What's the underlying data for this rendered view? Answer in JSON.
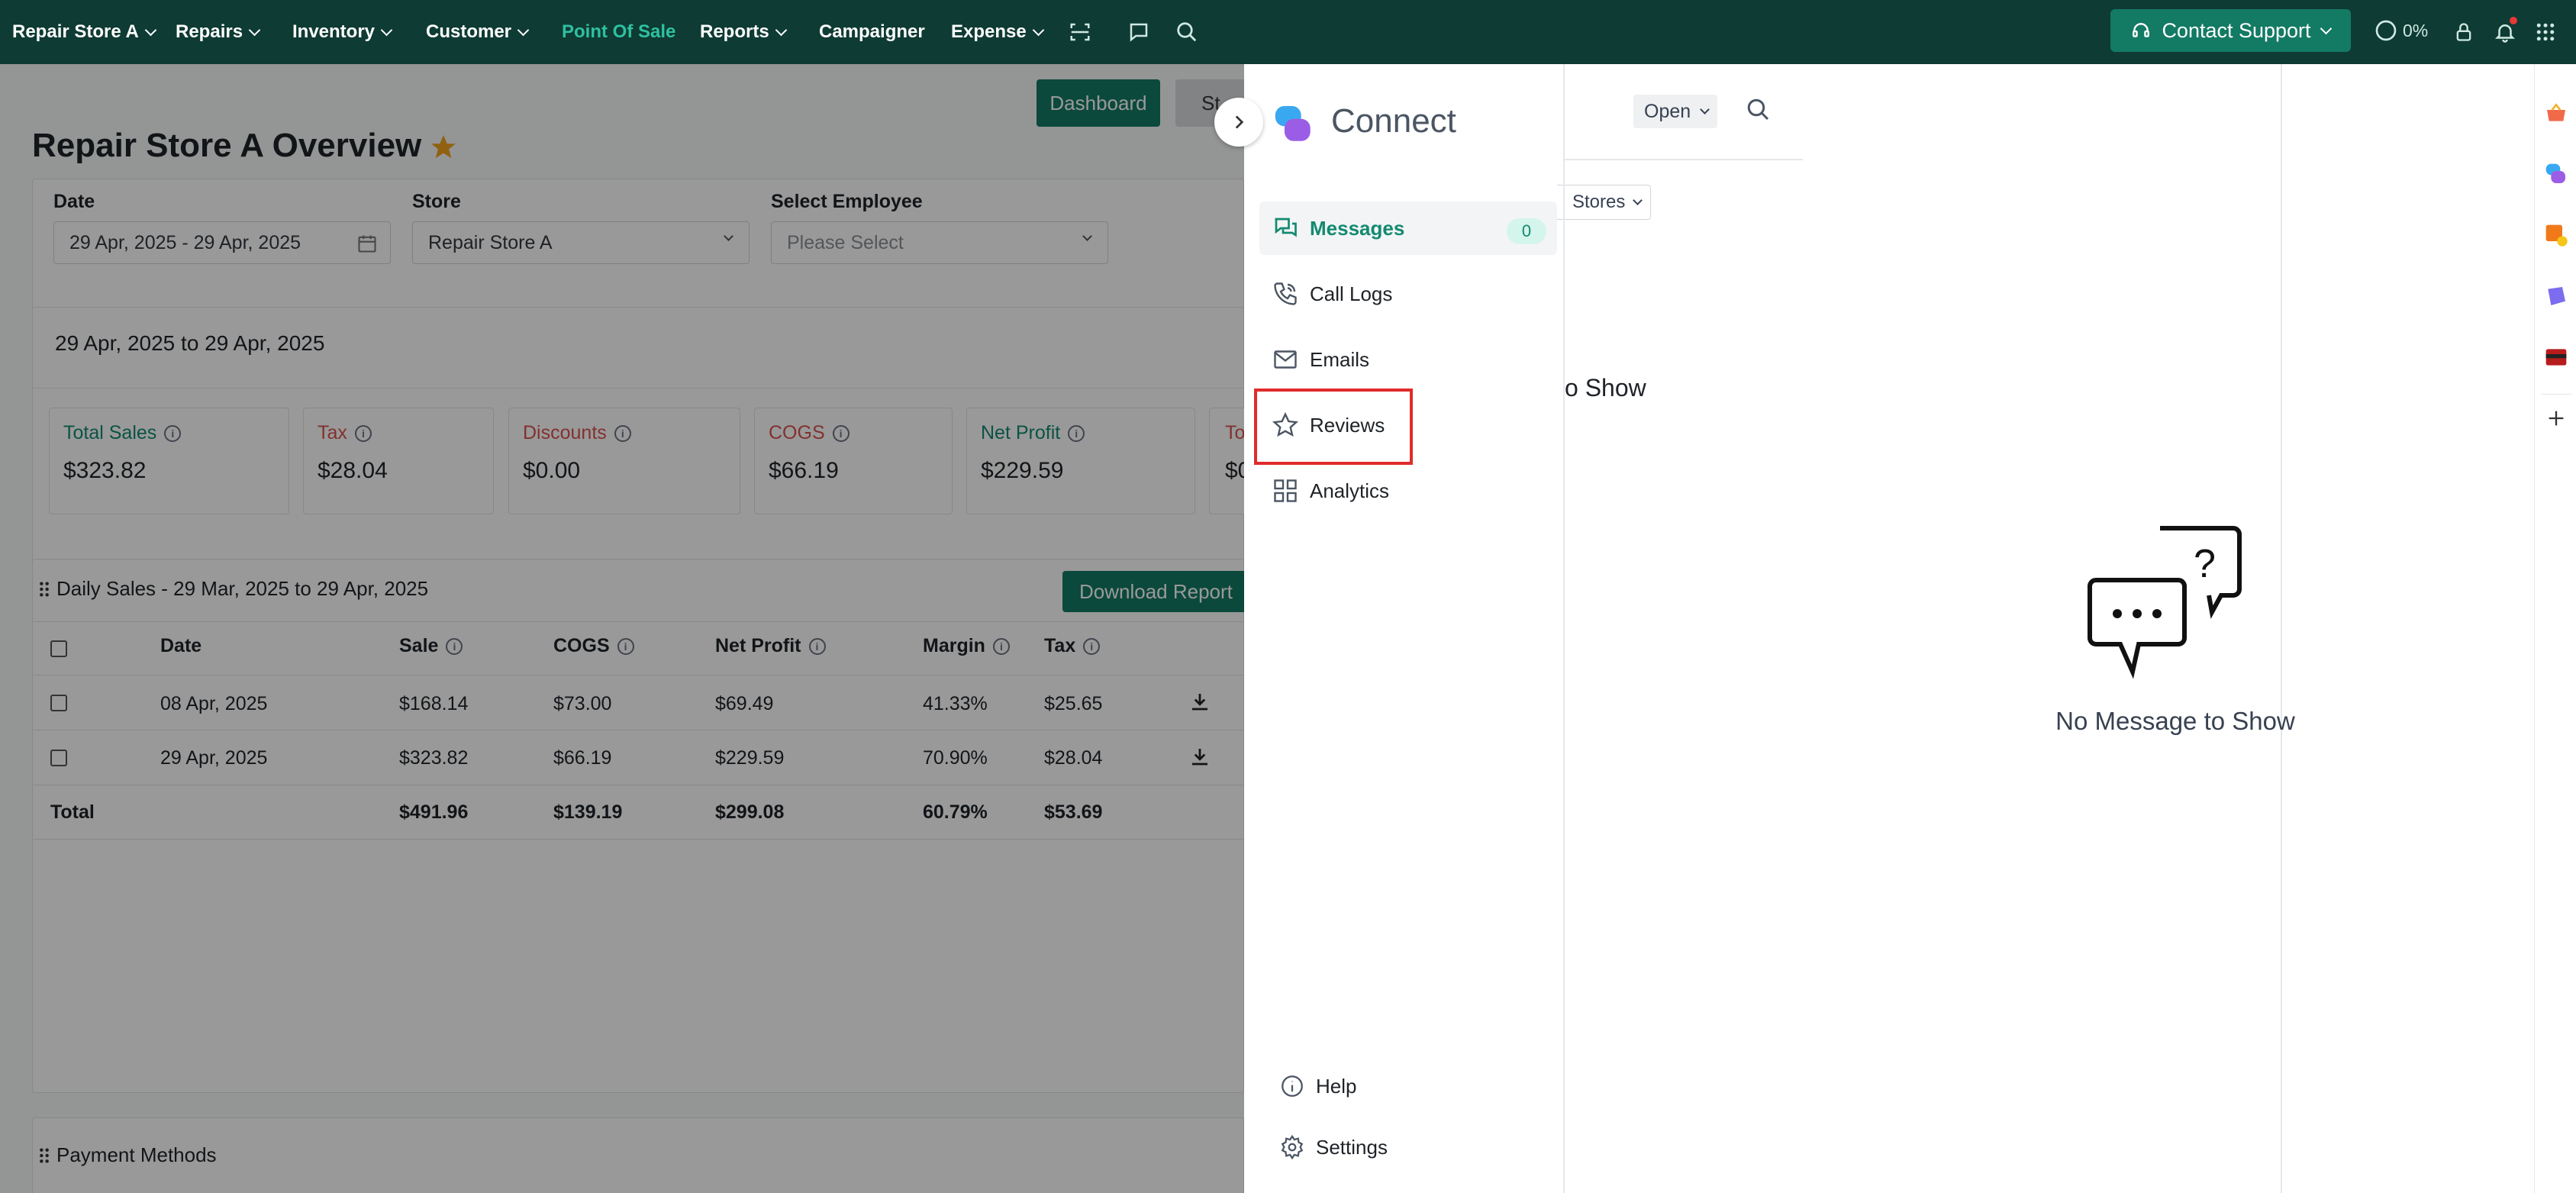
{
  "nav": {
    "items": [
      {
        "label": "Repair Store A",
        "chevron": true
      },
      {
        "label": "Repairs",
        "chevron": true
      },
      {
        "label": "Inventory",
        "chevron": true
      },
      {
        "label": "Customer",
        "chevron": true
      },
      {
        "label": "Point Of Sale",
        "chevron": false,
        "active": true
      },
      {
        "label": "Reports",
        "chevron": true
      },
      {
        "label": "Campaigner",
        "chevron": false
      },
      {
        "label": "Expense",
        "chevron": true
      }
    ],
    "support_label": "Contact Support",
    "progress_label": "0%",
    "colors": {
      "nav_bg": "#0e3b33",
      "accent": "#2fc0a0",
      "brand": "#137a64"
    }
  },
  "dashboard": {
    "btn_dashboard": "Dashboard",
    "btn_partial": "St",
    "title": "Repair Store A Overview",
    "filters": {
      "date_label": "Date",
      "date_value": "29 Apr, 2025 - 29 Apr, 2025",
      "store_label": "Store",
      "store_value": "Repair Store A",
      "employee_label": "Select Employee",
      "employee_placeholder": "Please Select"
    },
    "range_text": "29 Apr, 2025 to 29 Apr, 2025",
    "stats": [
      {
        "label": "Total Sales",
        "value": "$323.82",
        "color": "#138a70"
      },
      {
        "label": "Tax",
        "value": "$28.04",
        "color": "#d9534f"
      },
      {
        "label": "Discounts",
        "value": "$0.00",
        "color": "#d9534f"
      },
      {
        "label": "COGS",
        "value": "$66.19",
        "color": "#d9534f"
      },
      {
        "label": "Net Profit",
        "value": "$229.59",
        "color": "#138a70"
      },
      {
        "label": "To",
        "value": "$0",
        "color": "#d9534f"
      }
    ],
    "daily": {
      "title": "Daily Sales - 29 Mar, 2025 to 29 Apr, 2025",
      "download_label": "Download Report",
      "columns": [
        "Date",
        "Sale",
        "COGS",
        "Net Profit",
        "Margin",
        "Tax"
      ],
      "rows": [
        {
          "date": "08 Apr, 2025",
          "sale": "$168.14",
          "cogs": "$73.00",
          "net": "$69.49",
          "margin": "41.33%",
          "tax": "$25.65"
        },
        {
          "date": "29 Apr, 2025",
          "sale": "$323.82",
          "cogs": "$66.19",
          "net": "$229.59",
          "margin": "70.90%",
          "tax": "$28.04"
        }
      ],
      "total": {
        "label": "Total",
        "sale": "$491.96",
        "cogs": "$139.19",
        "net": "$299.08",
        "margin": "60.79%",
        "tax": "$53.69"
      }
    },
    "payment_title": "Payment Methods"
  },
  "connect": {
    "title": "Connect",
    "menu": [
      {
        "label": "Messages",
        "icon": "messages-icon",
        "badge": "0",
        "active": true
      },
      {
        "label": "Call Logs",
        "icon": "phone-icon"
      },
      {
        "label": "Emails",
        "icon": "mail-icon"
      },
      {
        "label": "Reviews",
        "icon": "star-icon",
        "highlighted": true
      },
      {
        "label": "Analytics",
        "icon": "grid-icon"
      }
    ],
    "help_label": "Help",
    "settings_label": "Settings",
    "filter_value": "Open",
    "stores_label": "Stores",
    "partial_empty": "o Show",
    "empty_text": "No Message to Show"
  }
}
